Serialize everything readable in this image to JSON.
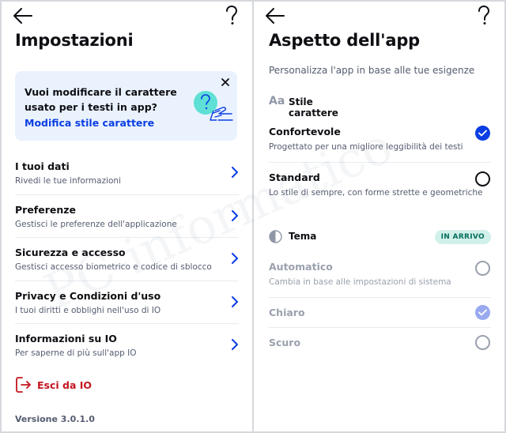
{
  "left_screen": {
    "title": "Impostazioni",
    "banner": {
      "text": "Vuoi modificare il carattere usato per i testi in app?",
      "link": "Modifica stile carattere",
      "illustration_icon": "question-hand-icon"
    },
    "items": [
      {
        "title": "I tuoi dati",
        "subtitle": "Rivedi le tue informazioni"
      },
      {
        "title": "Preferenze",
        "subtitle": "Gestisci le preferenze dell'applicazione"
      },
      {
        "title": "Sicurezza e accesso",
        "subtitle": "Gestisci accesso biometrico e codice di sblocco"
      },
      {
        "title": "Privacy e Condizioni d'uso",
        "subtitle": "I tuoi diritti e obblighi nell'uso di IO"
      },
      {
        "title": "Informazioni su IO",
        "subtitle": "Per saperne di più sull'app IO"
      }
    ],
    "logout_label": "Esci da IO",
    "version": "Versione 3.0.1.0"
  },
  "right_screen": {
    "title": "Aspetto dell'app",
    "subtitle": "Personalizza l'app in base alle tue esigenze",
    "style_section": {
      "icon_text": "Aa",
      "label": "Stile carattere",
      "options": [
        {
          "title": "Confortevole",
          "subtitle": "Progettato per una migliore leggibilità dei testi",
          "selected": true
        },
        {
          "title": "Standard",
          "subtitle": "Lo stile di sempre, con forme strette e geometriche",
          "selected": false
        }
      ]
    },
    "theme_section": {
      "label": "Tema",
      "badge": "IN ARRIVO",
      "options": [
        {
          "title": "Automatico",
          "subtitle": "Cambia in base alle impostazioni di sistema",
          "selected": false
        },
        {
          "title": "Chiaro",
          "subtitle": "",
          "selected": true
        },
        {
          "title": "Scuro",
          "subtitle": "",
          "selected": false
        }
      ]
    }
  },
  "watermark": "PC-informatico",
  "colors": {
    "accent_blue": "#0b3ee3",
    "danger_red": "#c3161e",
    "banner_bg": "#eaf2fd",
    "badge_bg": "#d2f0ea",
    "badge_text": "#046e5b"
  }
}
